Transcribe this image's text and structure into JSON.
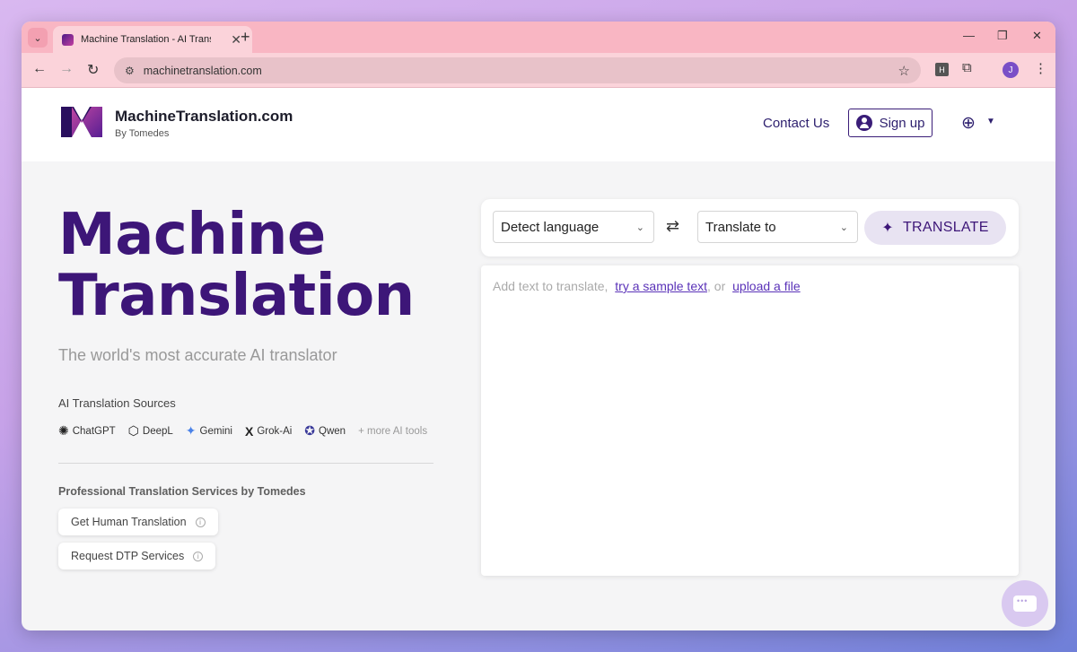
{
  "browser": {
    "tab_title": "Machine Translation - AI Transla",
    "url": "machinetranslation.com",
    "profile_initial": "J",
    "extension_label": "H"
  },
  "header": {
    "brand_name": "MachineTranslation.com",
    "brand_sub": "By Tomedes",
    "contact_label": "Contact Us",
    "signup_label": "Sign up"
  },
  "hero": {
    "title_line1": "Machine",
    "title_line2": "Translation",
    "subtitle": "The world's most accurate AI translator",
    "sources_label": "AI Translation Sources",
    "sources": [
      {
        "name": "ChatGPT",
        "icon": "chatgpt-icon"
      },
      {
        "name": "DeepL",
        "icon": "deepl-icon"
      },
      {
        "name": "Gemini",
        "icon": "gemini-icon"
      },
      {
        "name": "Grok-Ai",
        "icon": "grok-icon"
      },
      {
        "name": "Qwen",
        "icon": "qwen-icon"
      }
    ],
    "more_tools": "+ more AI tools",
    "pro_label": "Professional Translation Services by Tomedes",
    "human_translation": "Get Human Translation",
    "dtp_services": "Request DTP Services"
  },
  "translator": {
    "source_lang": "Detect language",
    "target_lang": "Translate to",
    "translate_button": "TRANSLATE",
    "placeholder_prefix": "Add text to translate,",
    "sample_link": "try a sample text",
    "or_text": ", or",
    "upload_link": "upload a file"
  },
  "colors": {
    "brand_purple": "#3d1678",
    "tab_strip": "#f9b6c3",
    "link": "#5a32b8"
  }
}
